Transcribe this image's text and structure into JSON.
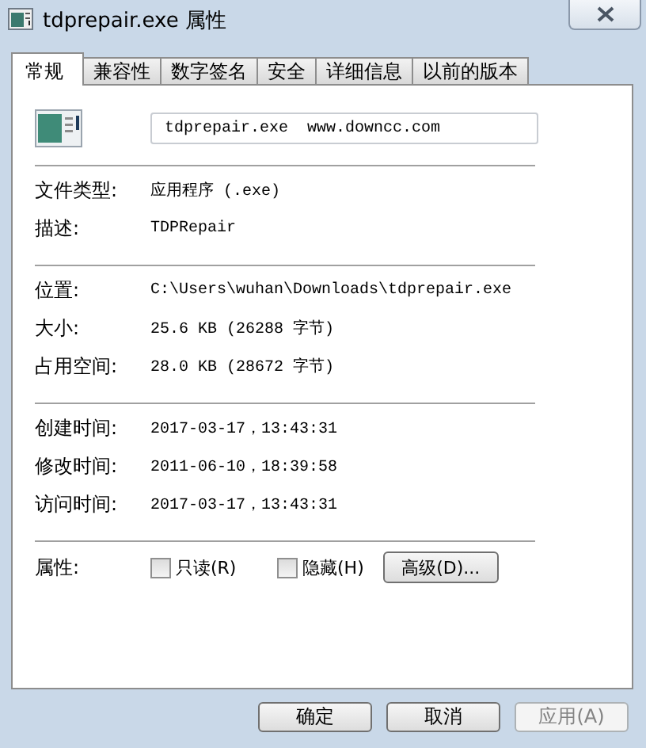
{
  "window": {
    "title": "tdprepair.exe 属性"
  },
  "tabs": [
    {
      "label": "常规",
      "selected": true
    },
    {
      "label": "兼容性",
      "selected": false
    },
    {
      "label": "数字签名",
      "selected": false
    },
    {
      "label": "安全",
      "selected": false
    },
    {
      "label": "详细信息",
      "selected": false
    },
    {
      "label": "以前的版本",
      "selected": false
    }
  ],
  "file_name": {
    "value": "tdprepair.exe  www.downcc.com"
  },
  "sections": [
    {
      "rows": [
        {
          "label": "文件类型:",
          "value": "应用程序 (.exe)"
        },
        {
          "label": "描述:",
          "value": "TDPRepair"
        }
      ]
    },
    {
      "rows": [
        {
          "label": "位置:",
          "value": "C:\\Users\\wuhan\\Downloads\\tdprepair.exe"
        },
        {
          "label": "大小:",
          "value": "25.6 KB (26288 字节)"
        },
        {
          "label": "占用空间:",
          "value": "28.0 KB (28672 字节)"
        }
      ]
    },
    {
      "rows": [
        {
          "label": "创建时间:",
          "value": "2017-03-17，13:43:31"
        },
        {
          "label": "修改时间:",
          "value": "2011-06-10，18:39:58"
        },
        {
          "label": "访问时间:",
          "value": "2017-03-17，13:43:31"
        }
      ]
    }
  ],
  "attributes": {
    "label": "属性:",
    "checkboxes": [
      {
        "label": "只读(R)",
        "checked": false
      },
      {
        "label": "隐藏(H)",
        "checked": false
      }
    ],
    "advanced_button": "高级(D)..."
  },
  "buttons": [
    {
      "label": "确定",
      "disabled": false
    },
    {
      "label": "取消",
      "disabled": false
    },
    {
      "label": "应用(A)",
      "disabled": true
    }
  ]
}
